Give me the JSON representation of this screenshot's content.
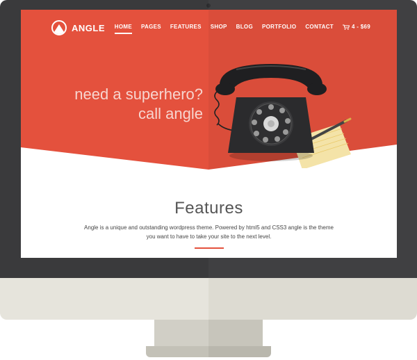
{
  "brand": {
    "name": "ANGLE"
  },
  "nav": {
    "items": [
      {
        "label": "HOME",
        "active": true
      },
      {
        "label": "PAGES",
        "active": false
      },
      {
        "label": "FEATURES",
        "active": false
      },
      {
        "label": "SHOP",
        "active": false
      },
      {
        "label": "BLOG",
        "active": false
      },
      {
        "label": "PORTFOLIO",
        "active": false
      },
      {
        "label": "CONTACT",
        "active": false
      }
    ],
    "cart_label": "4 - $69"
  },
  "hero": {
    "headline_line1": "need a superhero?",
    "headline_line2": "call angle"
  },
  "features": {
    "title": "Features",
    "description_line1": "Angle is a unique and outstanding wordpress theme. Powered by html5 and CSS3 angle is the theme",
    "description_line2": "you want to have to take your site to the next level."
  },
  "colors": {
    "accent": "#e4513d",
    "monitor": "#3a3a3c",
    "stand": "#e6e4dc"
  },
  "icons": [
    "angle-logo-icon",
    "cart-icon",
    "telephone-illustration",
    "notepad-illustration",
    "pen-illustration"
  ]
}
